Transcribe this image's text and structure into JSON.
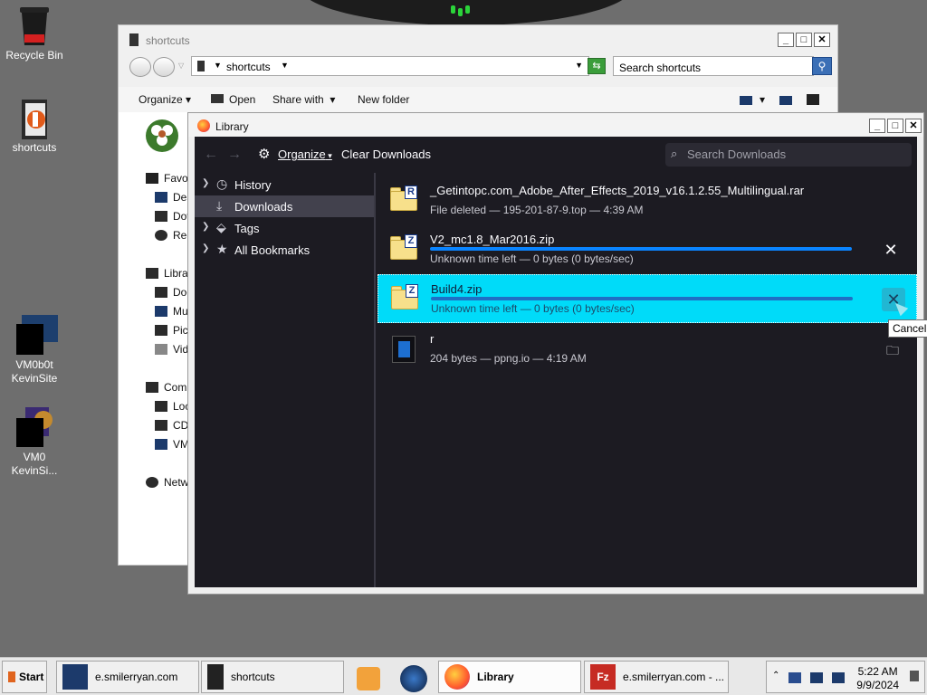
{
  "desktop": {
    "icons": [
      {
        "label": "Recycle Bin"
      },
      {
        "label": "shortcuts"
      },
      {
        "label": "VM0b0t\nKevinSite"
      },
      {
        "label": "VM0\nKevinSi..."
      }
    ]
  },
  "explorer": {
    "title": "shortcuts",
    "address": "shortcuts",
    "search_placeholder": "Search shortcuts",
    "toolbar": {
      "organize": "Organize",
      "open": "Open",
      "share_with": "Share with",
      "new_folder": "New folder"
    },
    "tree": [
      "Favor",
      "Des",
      "Dov",
      "Rec",
      "Librai",
      "Doc",
      "Mu",
      "Pict",
      "Vid",
      "Comp",
      "Loc",
      "CD",
      "VM",
      "Netw"
    ]
  },
  "library": {
    "title": "Library",
    "toolbar": {
      "organize": "Organize",
      "clear_downloads": "Clear Downloads",
      "search_placeholder": "Search Downloads"
    },
    "sidebar": [
      {
        "label": "History",
        "icon": "clock-icon",
        "selected": false
      },
      {
        "label": "Downloads",
        "icon": "download-icon",
        "selected": true
      },
      {
        "label": "Tags",
        "icon": "tag-icon",
        "selected": false
      },
      {
        "label": "All Bookmarks",
        "icon": "star-icon",
        "selected": false
      }
    ],
    "downloads": [
      {
        "name": "_Getintopc.com_Adobe_After_Effects_2019_v16.1.2.55_Multilingual.rar",
        "status": "File deleted — 195-201-87-9.top — 4:39 AM",
        "badge": "R",
        "kind": "folder",
        "progress": null,
        "action": "none"
      },
      {
        "name": "V2_mc1.8_Mar2016.zip",
        "status": "Unknown time left — 0 bytes (0 bytes/sec)",
        "badge": "Z",
        "kind": "folder",
        "progress": 1.0,
        "action": "cancel"
      },
      {
        "name": "Build4.zip",
        "status": "Unknown time left — 0 bytes (0 bytes/sec)",
        "badge": "Z",
        "kind": "folder",
        "progress": 1.0,
        "action": "cancel",
        "selected": true
      },
      {
        "name": "r",
        "status": "204 bytes — ppng.io — 4:19 AM",
        "badge": "",
        "kind": "file",
        "progress": null,
        "action": "open-folder"
      }
    ],
    "tooltip": "Cancel"
  },
  "taskbar": {
    "start": "Start",
    "buttons": [
      {
        "label": "e.smilerryan.com"
      },
      {
        "label": "shortcuts"
      },
      {
        "label": "Library",
        "active": true
      },
      {
        "label": "e.smilerryan.com - ..."
      }
    ],
    "clock_time": "5:22 AM",
    "clock_date": "9/9/2024"
  },
  "colors": {
    "desktop_bg": "#6e6e6e",
    "library_bg": "#1c1b22",
    "selected_row": "#00dbf9",
    "progress_bar": "#0a84ff"
  }
}
